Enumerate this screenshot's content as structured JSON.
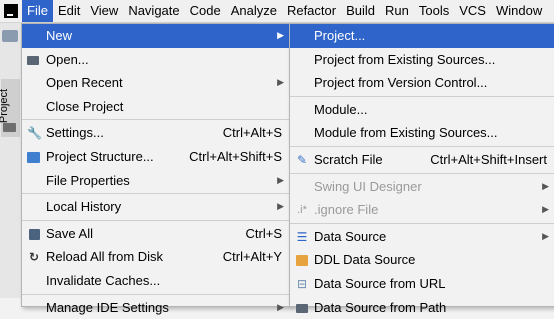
{
  "menubar": [
    "File",
    "Edit",
    "View",
    "Navigate",
    "Code",
    "Analyze",
    "Refactor",
    "Build",
    "Run",
    "Tools",
    "VCS",
    "Window"
  ],
  "sidebar": {
    "project_tab": "Project"
  },
  "file_menu": {
    "new": "New",
    "open": "Open...",
    "open_recent": "Open Recent",
    "close_project": "Close Project",
    "settings": "Settings...",
    "settings_sc": "Ctrl+Alt+S",
    "project_structure": "Project Structure...",
    "project_structure_sc": "Ctrl+Alt+Shift+S",
    "file_properties": "File Properties",
    "local_history": "Local History",
    "save_all": "Save All",
    "save_all_sc": "Ctrl+S",
    "reload": "Reload All from Disk",
    "reload_sc": "Ctrl+Alt+Y",
    "invalidate": "Invalidate Caches...",
    "manage_ide": "Manage IDE Settings"
  },
  "new_menu": {
    "project": "Project...",
    "from_existing": "Project from Existing Sources...",
    "from_vcs": "Project from Version Control...",
    "module": "Module...",
    "module_existing": "Module from Existing Sources...",
    "scratch": "Scratch File",
    "scratch_sc": "Ctrl+Alt+Shift+Insert",
    "swing": "Swing UI Designer",
    "ignore_icon": ".i*",
    "ignore": ".ignore File",
    "datasource": "Data Source",
    "ddl": "DDL Data Source",
    "ds_url": "Data Source from URL",
    "ds_path": "Data Source from Path"
  },
  "colors": {
    "selection": "#2f65ca",
    "menu_bg": "#f2f2f2",
    "disabled_text": "#9a9a9a"
  }
}
